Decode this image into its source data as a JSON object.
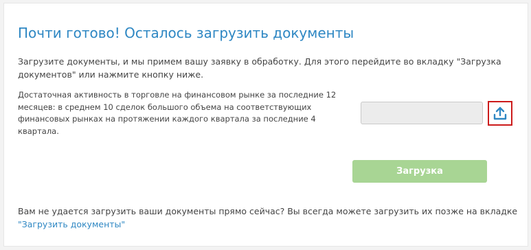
{
  "page": {
    "title": "Почти готово! Осталось загрузить документы",
    "intro": "Загрузите документы, и мы примем вашу заявку в обработку. Для этого перейдите во вкладку \"Загрузка документов\" или нажмите кнопку ниже."
  },
  "requirement": {
    "text": "Достаточная активность в торговле на финансовом рынке за последние 12 месяцев: в среднем 10 сделок большого объема на соответствующих финансовых рынках на протяжении каждого квартала за последние 4 квартала.",
    "file_value": "",
    "upload_icon": "upload-arrow-icon"
  },
  "actions": {
    "submit_label": "Загрузка"
  },
  "footer": {
    "text": "Вам не удается загрузить ваши документы прямо сейчас? Вы всегда можете загрузить их позже на вкладке",
    "link_label": "\"Загрузить документы\""
  },
  "colors": {
    "accent": "#2e87c3",
    "submit_bg": "#a8d594",
    "highlight_border": "#cc1b1b"
  }
}
